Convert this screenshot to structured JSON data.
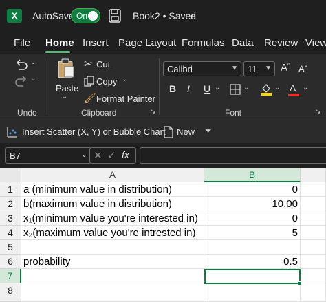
{
  "titlebar": {
    "app_icon": "X",
    "autosave_label": "AutoSave",
    "autosave_state": "On",
    "doc_title": "Book2 • Saved",
    "doc_chevron": "⌄"
  },
  "menu": {
    "tabs": [
      "File",
      "Home",
      "Insert",
      "Page Layout",
      "Formulas",
      "Data",
      "Review",
      "View"
    ],
    "active": "Home"
  },
  "ribbon": {
    "undo_group_label": "Undo",
    "paste_label": "Paste",
    "cut_label": "Cut",
    "copy_label": "Copy",
    "format_painter_label": "Format Painter",
    "clipboard_group_label": "Clipboard",
    "font_name": "Calibri",
    "font_size": "11",
    "bold": "B",
    "italic": "I",
    "underline": "U",
    "font_group_label": "Font",
    "highlight_color": "#ffd800",
    "font_color": "#e03131"
  },
  "qat": {
    "insert_chart_label": "Insert Scatter (X, Y) or Bubble Chart",
    "new_label": "New"
  },
  "formula_bar": {
    "name_box": "B7",
    "formula": ""
  },
  "grid": {
    "columns": [
      "A",
      "B"
    ],
    "rows": [
      {
        "num": "1",
        "a": "a (minimum value in distribution)",
        "b": "0"
      },
      {
        "num": "2",
        "a": "b(maximum value in distribution)",
        "b": "10.00"
      },
      {
        "num": "3",
        "a": "x₁(minimum value you're interested in)",
        "b": "0"
      },
      {
        "num": "4",
        "a": "x₂(maximum value you're intrested in)",
        "b": "5"
      },
      {
        "num": "5",
        "a": "",
        "b": ""
      },
      {
        "num": "6",
        "a": "probability",
        "b": "0.5"
      },
      {
        "num": "7",
        "a": "",
        "b": ""
      },
      {
        "num": "8",
        "a": "",
        "b": ""
      }
    ]
  }
}
